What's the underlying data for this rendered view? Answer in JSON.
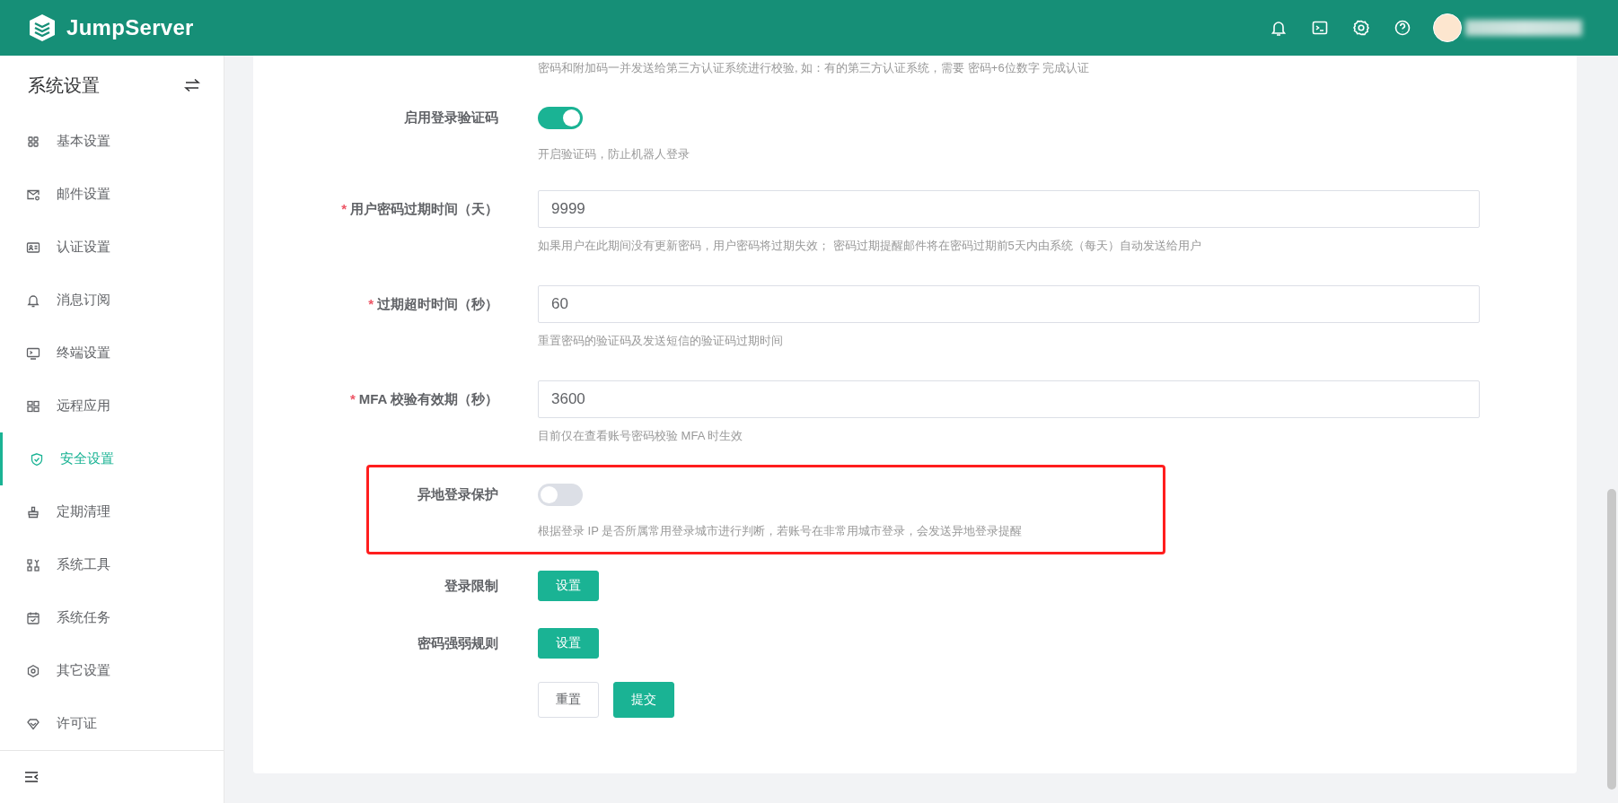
{
  "header": {
    "logo": "JumpServer"
  },
  "sidebar": {
    "title": "系统设置",
    "items": [
      {
        "label": "基本设置",
        "selected": false
      },
      {
        "label": "邮件设置",
        "selected": false
      },
      {
        "label": "认证设置",
        "selected": false
      },
      {
        "label": "消息订阅",
        "selected": false
      },
      {
        "label": "终端设置",
        "selected": false
      },
      {
        "label": "远程应用",
        "selected": false
      },
      {
        "label": "安全设置",
        "selected": true
      },
      {
        "label": "定期清理",
        "selected": false
      },
      {
        "label": "系统工具",
        "selected": false
      },
      {
        "label": "系统任务",
        "selected": false
      },
      {
        "label": "其它设置",
        "selected": false
      },
      {
        "label": "许可证",
        "selected": false
      }
    ]
  },
  "form": {
    "top_help": "密码和附加码一并发送给第三方认证系统进行校验, 如：有的第三方认证系统，需要 密码+6位数字 完成认证",
    "rows": [
      {
        "kind": "switch",
        "label": "启用登录验证码",
        "on": true,
        "help": "开启验证码，防止机器人登录",
        "highlighted": false
      },
      {
        "kind": "input",
        "required_mark": "*",
        "label": "用户密码过期时间（天）",
        "value": "9999",
        "help": "如果用户在此期间没有更新密码，用户密码将过期失效； 密码过期提醒邮件将在密码过期前5天内由系统（每天）自动发送给用户",
        "highlighted": false
      },
      {
        "kind": "input",
        "required_mark": "*",
        "label": "过期超时时间（秒）",
        "value": "60",
        "help": "重置密码的验证码及发送短信的验证码过期时间",
        "highlighted": false
      },
      {
        "kind": "input",
        "required_mark": "*",
        "label": "MFA 校验有效期（秒）",
        "value": "3600",
        "help": "目前仅在查看账号密码校验 MFA 时生效",
        "highlighted": false
      },
      {
        "kind": "switch",
        "label": "异地登录保护",
        "on": false,
        "help": "根据登录 IP 是否所属常用登录城市进行判断，若账号在非常用城市登录，会发送异地登录提醒",
        "highlighted": true
      },
      {
        "kind": "button",
        "label": "登录限制",
        "button": "设置",
        "highlighted": false
      },
      {
        "kind": "button",
        "label": "密码强弱规则",
        "button": "设置",
        "highlighted": false
      }
    ],
    "actions": [
      {
        "label": "重置",
        "kind": "default"
      },
      {
        "label": "提交",
        "kind": "primary"
      }
    ]
  }
}
